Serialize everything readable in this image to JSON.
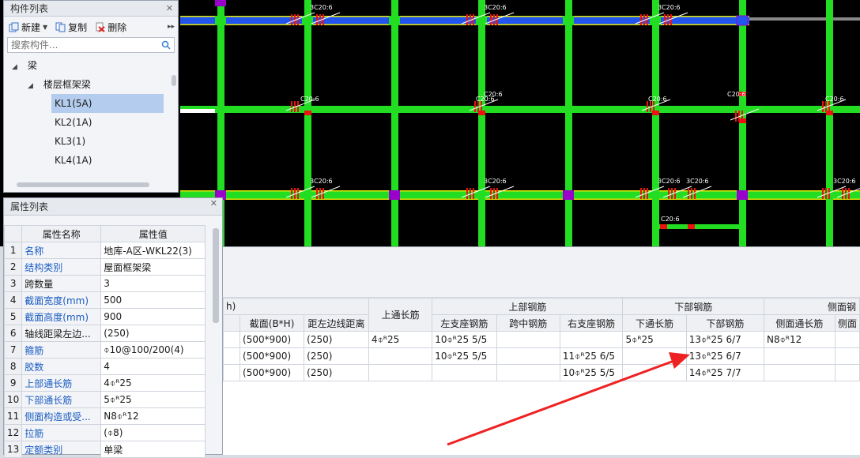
{
  "canvas": {
    "labels": [
      "3C20:6",
      "3C20:6",
      "3C20:6",
      "C20:6",
      "C20:6",
      "C20:6",
      "C20:6",
      "3C20:6",
      "3C20:6",
      "3C20:6",
      "3C20:6",
      "3C20:6",
      "C20:6",
      "C20:6",
      "C20:6"
    ]
  },
  "component_panel": {
    "title": "构件列表",
    "toolbar": {
      "new": "新建",
      "copy": "复制",
      "delete": "删除",
      "more": "▸▸"
    },
    "search_placeholder": "搜索构件...",
    "tree": {
      "root": "梁",
      "group": "楼层框架梁",
      "items": [
        "KL1(5A)",
        "KL2(1A)",
        "KL3(1)",
        "KL4(1A)"
      ]
    }
  },
  "property_panel": {
    "title": "属性列表",
    "headers": {
      "name": "属性名称",
      "value": "属性值"
    },
    "rows": [
      {
        "idx": "1",
        "name": "名称",
        "value": "地库-A区-WKL22(3)",
        "blue": true
      },
      {
        "idx": "2",
        "name": "结构类别",
        "value": "屋面框架梁",
        "blue": true
      },
      {
        "idx": "3",
        "name": "跨数量",
        "value": "3",
        "blue": false
      },
      {
        "idx": "4",
        "name": "截面宽度(mm)",
        "value": "500",
        "blue": true
      },
      {
        "idx": "5",
        "name": "截面高度(mm)",
        "value": "900",
        "blue": true
      },
      {
        "idx": "6",
        "name": "轴线距梁左边...",
        "value": "(250)",
        "blue": false
      },
      {
        "idx": "7",
        "name": "箍筋",
        "value": "⌽10@100/200(4)",
        "blue": true
      },
      {
        "idx": "8",
        "name": "胶数",
        "value": "4",
        "blue": true
      },
      {
        "idx": "9",
        "name": "上部通长筋",
        "value": "4⌽ᴿ25",
        "blue": true
      },
      {
        "idx": "10",
        "name": "下部通长筋",
        "value": "5⌽ᴿ25",
        "blue": true
      },
      {
        "idx": "11",
        "name": "侧面构造或受...",
        "value": "N8⌽ᴿ12",
        "blue": true
      },
      {
        "idx": "12",
        "name": "拉筋",
        "value": "(⌽8)",
        "blue": true
      },
      {
        "idx": "13",
        "name": "定额类别",
        "value": "单梁",
        "blue": true
      }
    ]
  },
  "rebar_grid": {
    "group_headers": {
      "left_partial": "h)",
      "top": "上部钢筋",
      "bottom": "下部钢筋",
      "side": "侧面钢"
    },
    "columns": [
      "截面(B*H)",
      "距左边线距离",
      "上通长筋",
      "左支座钢筋",
      "跨中钢筋",
      "右支座钢筋",
      "下通长筋",
      "下部钢筋",
      "侧面通长筋",
      "侧面"
    ],
    "rows": [
      [
        "(500*900)",
        "(250)",
        "4⌽ᴿ25",
        "10⌽ᴿ25 5/5",
        "",
        "",
        "5⌽ᴿ25",
        "13⌽ᴿ25 6/7",
        "N8⌽ᴿ12",
        ""
      ],
      [
        "(500*900)",
        "(250)",
        "",
        "10⌽ᴿ25 5/5",
        "",
        "11⌽ᴿ25 6/5",
        "",
        "13⌽ᴿ25 6/7",
        "",
        ""
      ],
      [
        "(500*900)",
        "(250)",
        "",
        "",
        "",
        "10⌽ᴿ25 5/5",
        "",
        "14⌽ᴿ25 7/7",
        "",
        ""
      ]
    ]
  },
  "colors": {
    "beam_green": "#22dd22",
    "selected_beam": "#2255ee",
    "column_purple": "#9900cc",
    "rebar_red": "#ee1111",
    "arrow_red": "#ee2222"
  }
}
